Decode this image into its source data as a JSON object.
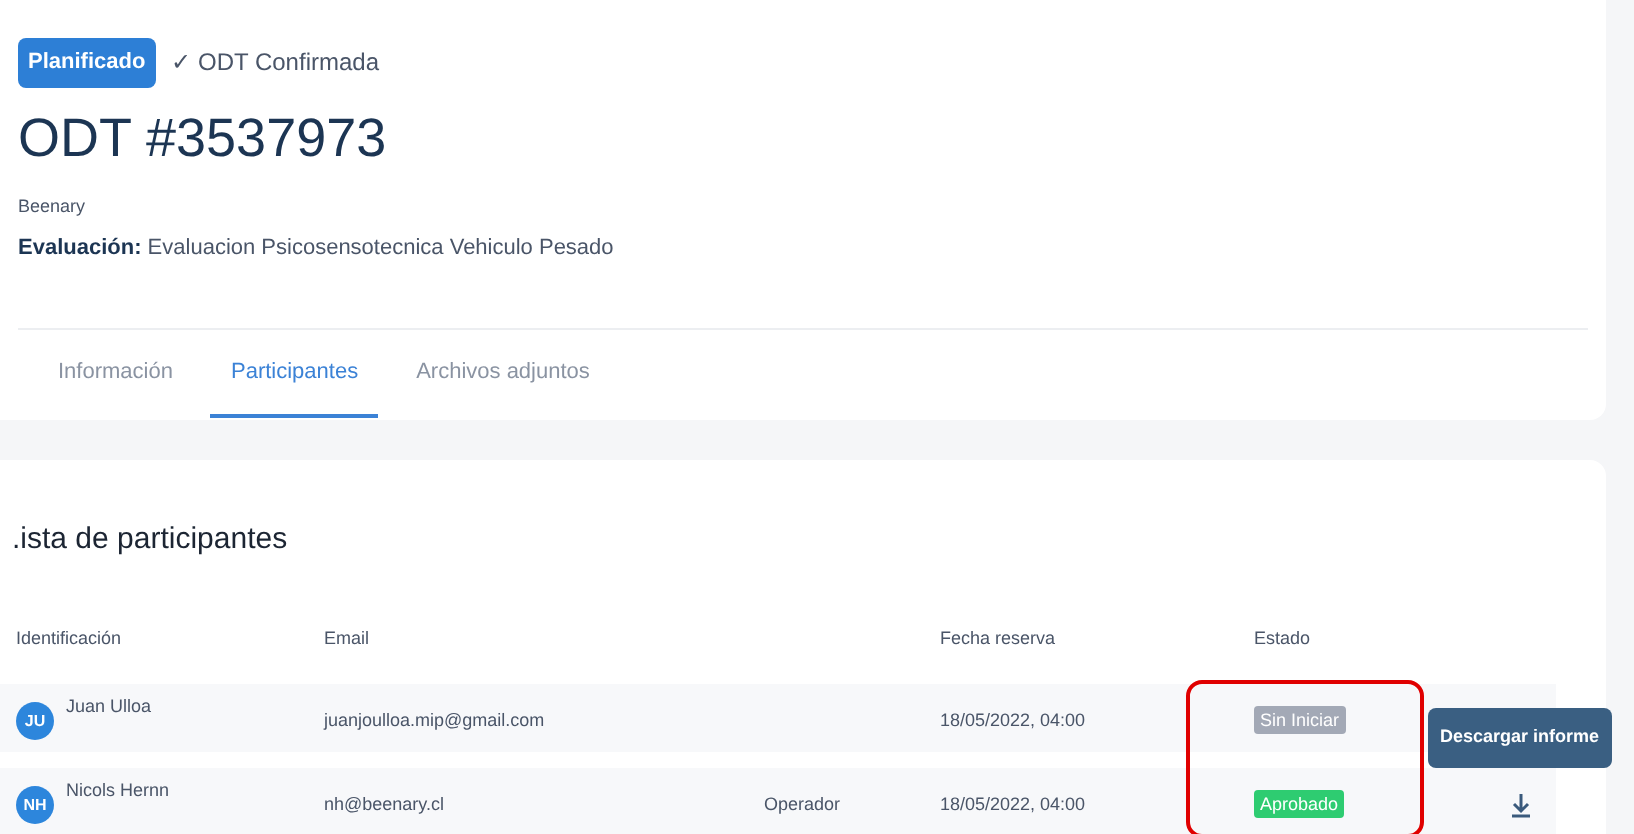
{
  "header": {
    "badge": "Planificado",
    "confirmation": "✓ ODT Confirmada",
    "title": "ODT #3537973",
    "company": "Beenary",
    "evaluation_label": "Evaluación:",
    "evaluation": "Evaluacion Psicosensotecnica Vehiculo Pesado"
  },
  "tabs": [
    {
      "label": "Información",
      "selected": false
    },
    {
      "label": "Participantes",
      "selected": true
    },
    {
      "label": "Archivos adjuntos",
      "selected": false
    }
  ],
  "participants": {
    "title": ".ista de participantes",
    "columns": [
      "Identificación",
      "Email",
      "Fecha reserva",
      "Estado"
    ],
    "rows": [
      {
        "initials": "JU",
        "name": "Juan Ulloa",
        "email": "juanjoulloa.mip@gmail.com",
        "date": "18/05/2022, 04:00",
        "status": "Sin Iniciar",
        "color": "#a3a9b6"
      },
      {
        "initials": "NH",
        "name": "Nicols Hernn",
        "email": "nh@beenary.cl",
        "role": "Operador",
        "date": "18/05/2022, 04:00",
        "status": "Aprobado",
        "color": "#2ecc71",
        "download": true
      }
    ]
  },
  "tooltip": "Descargar informe"
}
